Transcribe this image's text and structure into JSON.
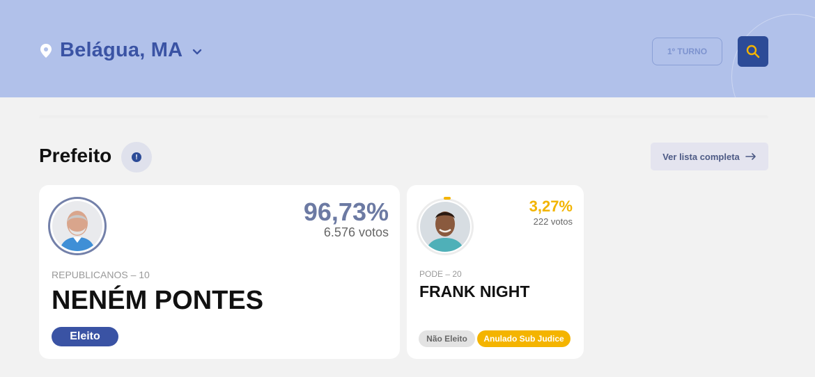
{
  "header": {
    "city": "Belágua, MA",
    "turno_label": "1º TURNO",
    "colors": {
      "background": "#b1c1ea",
      "brand": "#2c4b97",
      "accent": "#3a53a4"
    },
    "icons": {
      "location": "map-pin-icon",
      "dropdown": "chevron-down-icon",
      "search": "search-icon"
    }
  },
  "section": {
    "title": "Prefeito",
    "info_icon_text": "!",
    "list_button_label": "Ver lista completa"
  },
  "candidates": [
    {
      "percent": "96,73%",
      "votes": "6.576 votos",
      "party": "REPUBLICANOS – 10",
      "name": "NENÉM PONTES",
      "badges": [
        "Eleito"
      ],
      "vote_fraction": 0.9673,
      "color": "#6c7aa3"
    },
    {
      "percent": "3,27%",
      "votes": "222 votos",
      "party": "PODE – 20",
      "name": "FRANK NIGHT",
      "badges": [
        "Não Eleito",
        "Anulado Sub Judice"
      ],
      "vote_fraction": 0.0327,
      "color": "#f2b400"
    }
  ]
}
